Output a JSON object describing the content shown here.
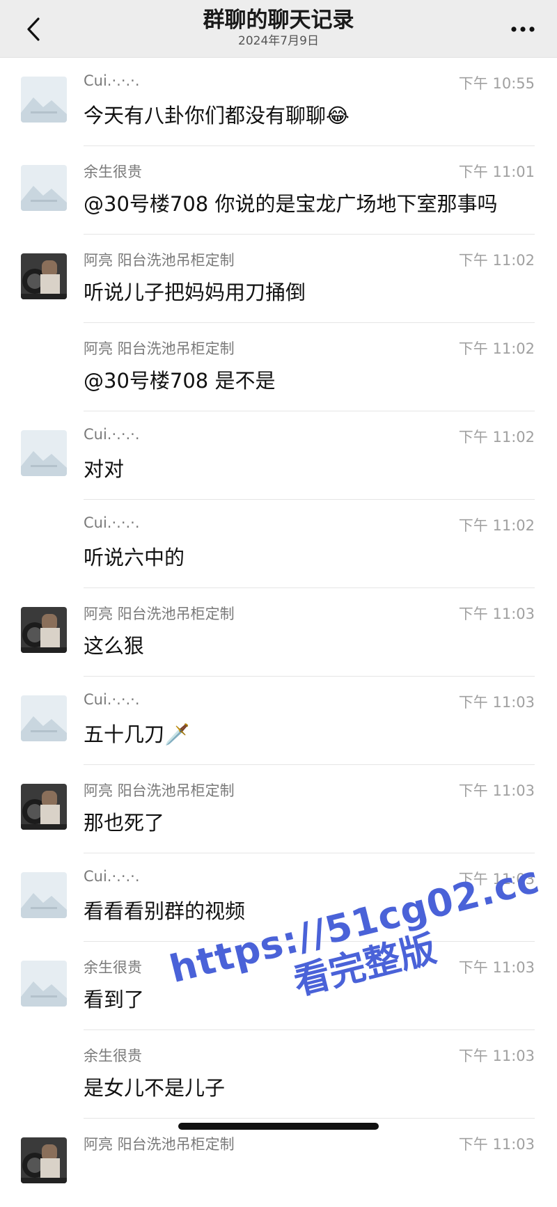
{
  "header": {
    "title": "群聊的聊天记录",
    "date": "2024年7月9日",
    "back_icon": "chevron-left-icon",
    "more_icon": "more-horizontal-icon"
  },
  "colors": {
    "header_bg": "#ededed",
    "name": "#7a7a7a",
    "time": "#a0a0a0",
    "watermark": "#4a62d8"
  },
  "messages": [
    {
      "avatar": "placeholder",
      "name": "Cui.·.·.·.",
      "time": "下午 10:55",
      "text": "今天有八卦你们都没有聊聊😂"
    },
    {
      "avatar": "placeholder",
      "name": "余生很贵",
      "time": "下午 11:01",
      "text": "@30号楼708 你说的是宝龙广场地下室那事吗"
    },
    {
      "avatar": "photo",
      "name": "阿亮 阳台洗池吊柜定制",
      "time": "下午 11:02",
      "text": "听说儿子把妈妈用刀捅倒"
    },
    {
      "avatar": "none",
      "name": "阿亮 阳台洗池吊柜定制",
      "time": "下午 11:02",
      "text": "@30号楼708 是不是"
    },
    {
      "avatar": "placeholder",
      "name": "Cui.·.·.·.",
      "time": "下午 11:02",
      "text": "对对"
    },
    {
      "avatar": "none",
      "name": "Cui.·.·.·.",
      "time": "下午 11:02",
      "text": "听说六中的"
    },
    {
      "avatar": "photo",
      "name": "阿亮 阳台洗池吊柜定制",
      "time": "下午 11:03",
      "text": "这么狠"
    },
    {
      "avatar": "placeholder",
      "name": "Cui.·.·.·.",
      "time": "下午 11:03",
      "text": "五十几刀🗡️"
    },
    {
      "avatar": "photo",
      "name": "阿亮 阳台洗池吊柜定制",
      "time": "下午 11:03",
      "text": "那也死了"
    },
    {
      "avatar": "placeholder",
      "name": "Cui.·.·.·.",
      "time": "下午 11:03",
      "text": "看看看别群的视频"
    },
    {
      "avatar": "placeholder",
      "name": "余生很贵",
      "time": "下午 11:03",
      "text": "看到了"
    },
    {
      "avatar": "none",
      "name": "余生很贵",
      "time": "下午 11:03",
      "text": "是女儿不是儿子"
    },
    {
      "avatar": "photo",
      "name": "阿亮 阳台洗池吊柜定制",
      "time": "下午 11:03",
      "text": ""
    }
  ],
  "watermark": {
    "url": "https://51cg02.cc",
    "subtitle": "看完整版"
  }
}
